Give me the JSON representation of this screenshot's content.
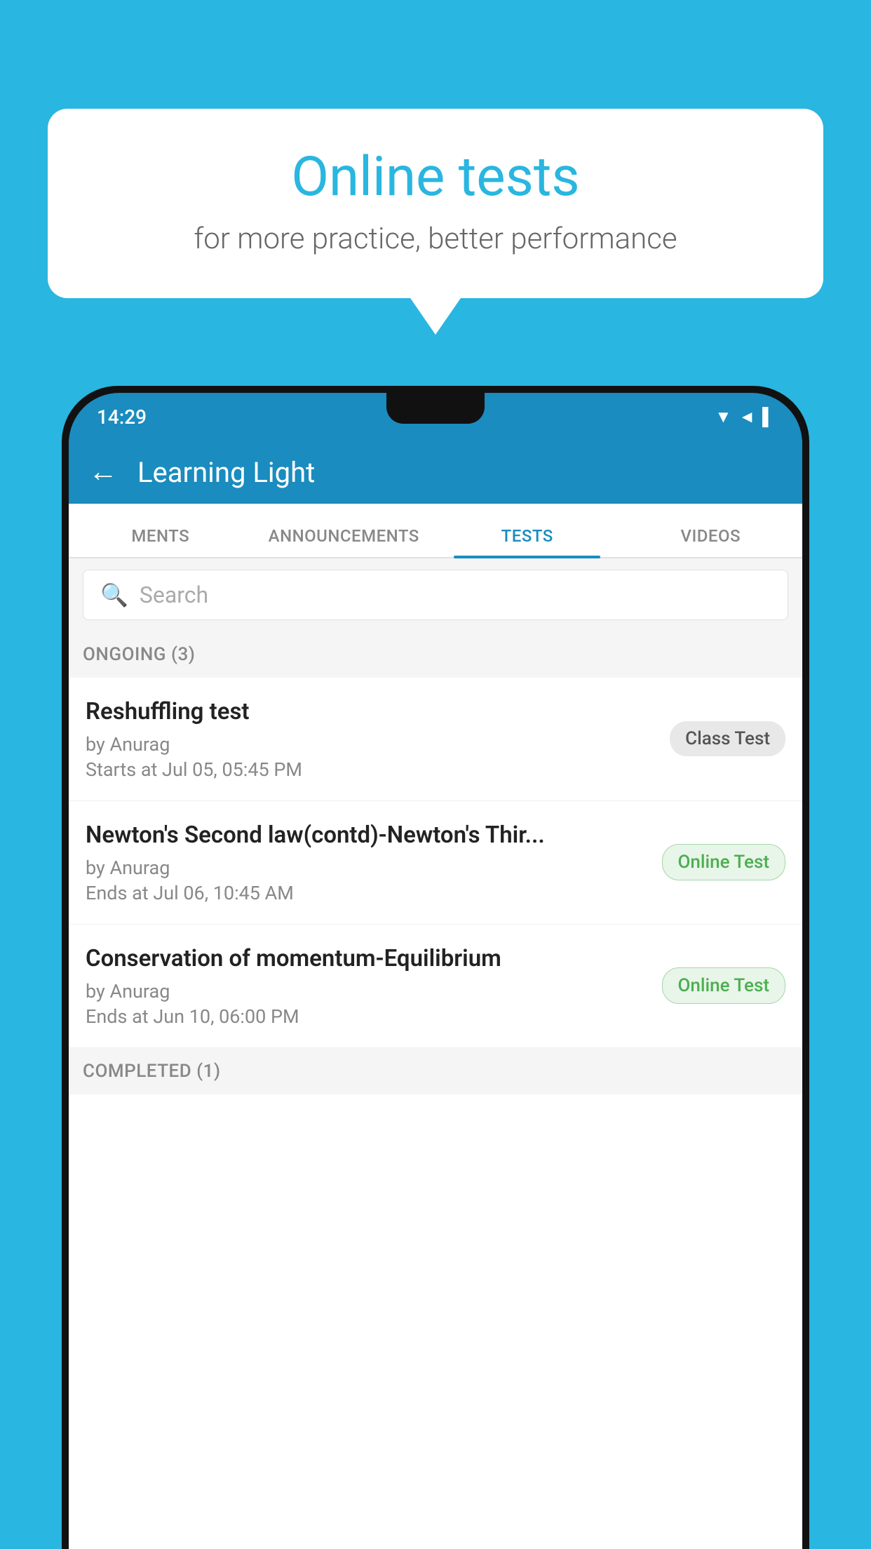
{
  "background_color": "#29b6e0",
  "bubble": {
    "title": "Online tests",
    "subtitle": "for more practice, better performance"
  },
  "phone": {
    "status_bar": {
      "time": "14:29",
      "icons": "▼◄▌"
    },
    "header": {
      "back_label": "←",
      "title": "Learning Light"
    },
    "tabs": [
      {
        "label": "MENTS",
        "active": false
      },
      {
        "label": "ANNOUNCEMENTS",
        "active": false
      },
      {
        "label": "TESTS",
        "active": true
      },
      {
        "label": "VIDEOS",
        "active": false
      }
    ],
    "search": {
      "placeholder": "Search"
    },
    "ongoing_section": {
      "label": "ONGOING (3)"
    },
    "tests": [
      {
        "name": "Reshuffling test",
        "by": "by Anurag",
        "date": "Starts at  Jul 05, 05:45 PM",
        "badge": "Class Test",
        "badge_type": "class"
      },
      {
        "name": "Newton's Second law(contd)-Newton's Thir...",
        "by": "by Anurag",
        "date": "Ends at  Jul 06, 10:45 AM",
        "badge": "Online Test",
        "badge_type": "online"
      },
      {
        "name": "Conservation of momentum-Equilibrium",
        "by": "by Anurag",
        "date": "Ends at  Jun 10, 06:00 PM",
        "badge": "Online Test",
        "badge_type": "online"
      }
    ],
    "completed_section": {
      "label": "COMPLETED (1)"
    }
  }
}
